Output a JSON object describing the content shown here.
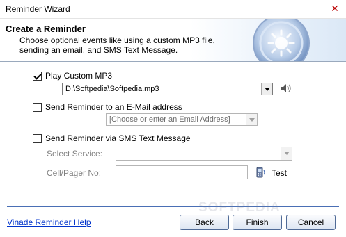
{
  "window": {
    "title": "Reminder Wizard",
    "close_glyph": "✕"
  },
  "banner": {
    "heading": "Create a Reminder",
    "description": "Choose optional events like using a custom MP3 file, sending an email, and SMS Text Message."
  },
  "mp3": {
    "label": "Play Custom MP3",
    "checked": true,
    "file": "D:\\Softpedia\\Softpedia.mp3",
    "speaker_icon": "speaker-icon"
  },
  "email": {
    "label": "Send Reminder to an E-Mail address",
    "checked": false,
    "placeholder": "[Choose or enter an Email Address]"
  },
  "sms": {
    "label": "Send Reminder via SMS Text Message",
    "checked": false,
    "service_label": "Select Service:",
    "service_value": "",
    "phone_label": "Cell/Pager No:",
    "phone_value": "",
    "test_label": "Test",
    "phone_icon": "phone-icon"
  },
  "footer": {
    "help_link": "Vinade Reminder Help",
    "back_label": "Back",
    "finish_label": "Finish",
    "cancel_label": "Cancel"
  },
  "watermark": "SOFTPEDIA",
  "colors": {
    "link": "#0033cc",
    "separator": "#4a6fb5",
    "close": "#bb0000"
  }
}
